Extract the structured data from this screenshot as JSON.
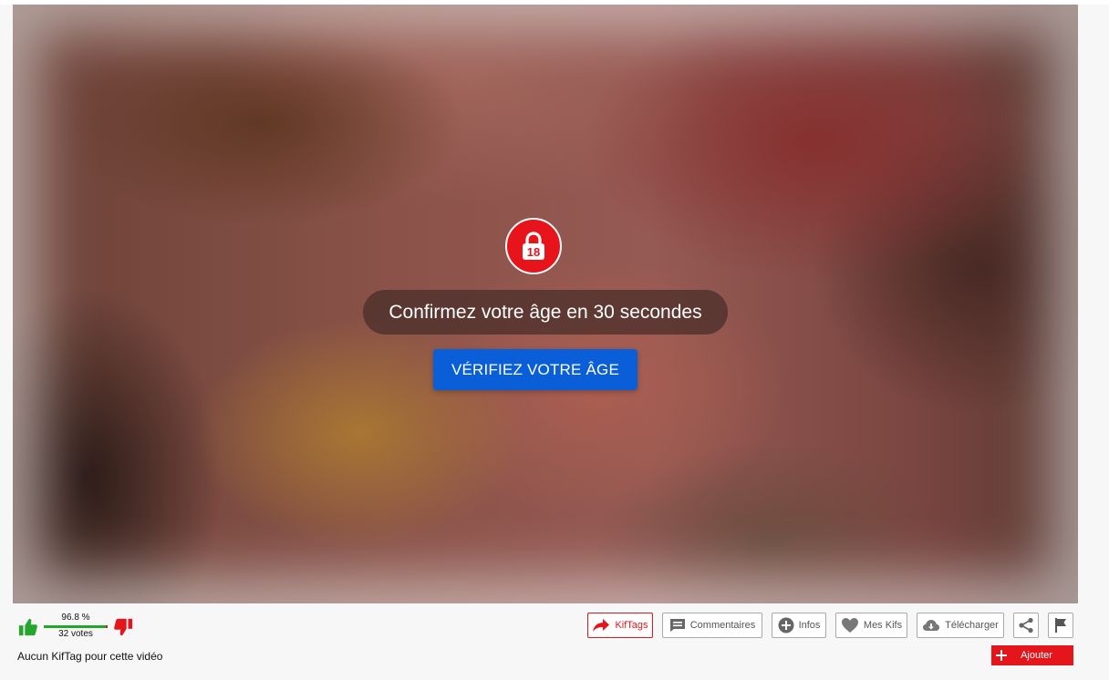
{
  "age_gate": {
    "badge_text": "18",
    "countdown_text": "Confirmez votre âge en 30 secondes",
    "verify_button_label": "VÉRIFIEZ VOTRE ÂGE"
  },
  "rating": {
    "percent_label": "96.8 %",
    "votes_label": "32 votes",
    "positive_fraction": 0.968
  },
  "toolbar": {
    "kiftags_label": "KifTags",
    "comments_label": "Commentaires",
    "infos_label": "Infos",
    "favorites_label": "Mes Kifs",
    "download_label": "Télécharger",
    "add_label": "Ajouter"
  },
  "kiftag_note": "Aucun KifTag pour cette vidéo",
  "colors": {
    "brand_red": "#e4161c",
    "verify_blue": "#0a5fd8",
    "thumb_up_green": "#24a52c"
  },
  "icons": {
    "lock": "lock-18-icon",
    "thumb_up": "thumb-up-icon",
    "thumb_down": "thumb-down-icon",
    "kiftags": "share-arrow-icon",
    "comments": "comment-icon",
    "infos": "plus-circle-icon",
    "favorites": "heart-icon",
    "download": "cloud-download-icon",
    "share": "share-icon",
    "report": "flag-icon",
    "add": "plus-icon"
  }
}
